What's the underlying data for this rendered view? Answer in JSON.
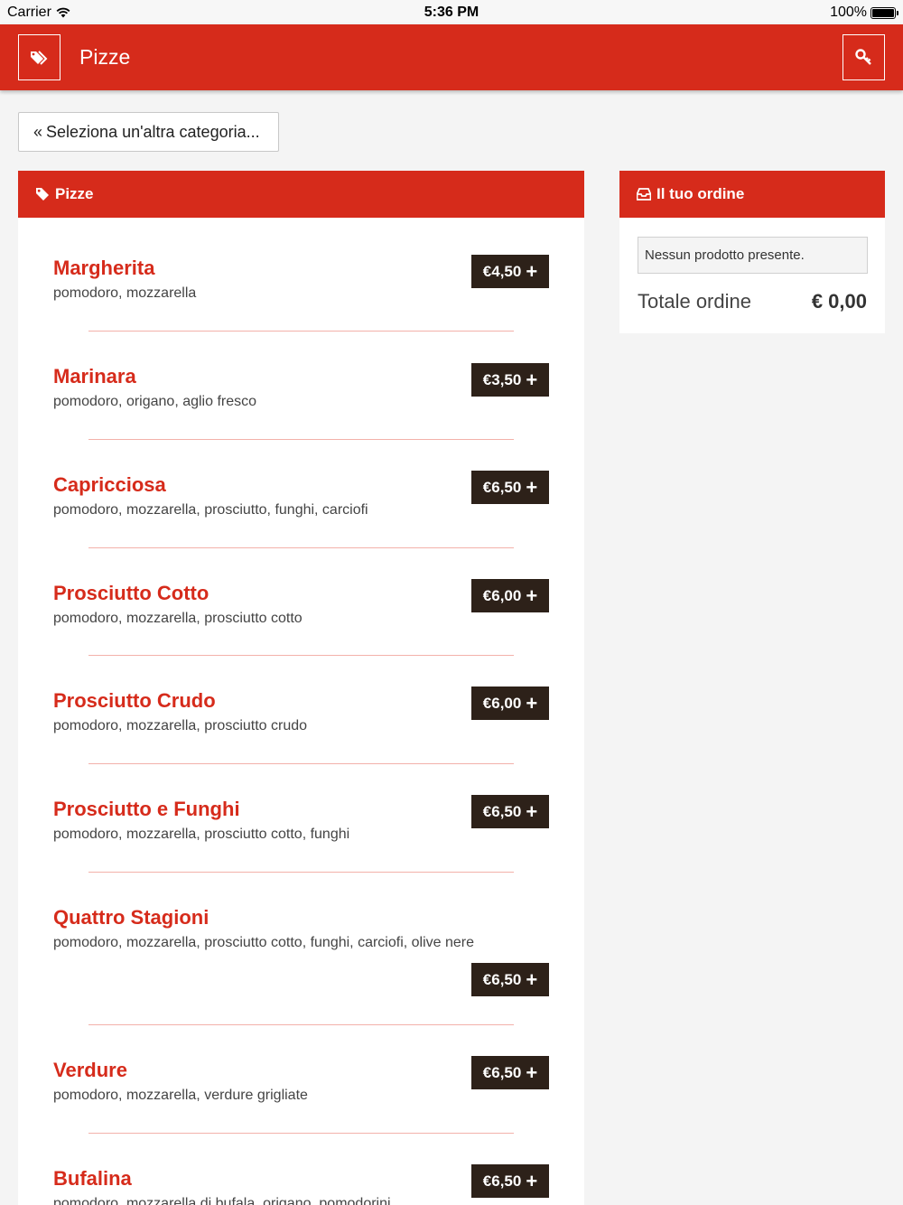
{
  "status_bar": {
    "carrier": "Carrier",
    "time": "5:36 PM",
    "battery": "100%"
  },
  "navbar": {
    "title": "Pizze",
    "left_icon": "tags-icon",
    "right_icon": "key-icon"
  },
  "back_button": {
    "label": "Seleziona un'altra categoria...",
    "icon": "double-chevron-left-icon"
  },
  "menu_panel": {
    "title": "Pizze",
    "items": [
      {
        "name": "Margherita",
        "desc": "pomodoro, mozzarella",
        "price": "€4,50"
      },
      {
        "name": "Marinara",
        "desc": "pomodoro, origano, aglio fresco",
        "price": "€3,50"
      },
      {
        "name": "Capricciosa",
        "desc": "pomodoro, mozzarella, prosciutto, funghi, carciofi",
        "price": "€6,50"
      },
      {
        "name": "Prosciutto Cotto",
        "desc": "pomodoro, mozzarella, prosciutto cotto",
        "price": "€6,00"
      },
      {
        "name": "Prosciutto Crudo",
        "desc": "pomodoro, mozzarella, prosciutto crudo",
        "price": "€6,00"
      },
      {
        "name": "Prosciutto e Funghi",
        "desc": "pomodoro, mozzarella, prosciutto cotto, funghi",
        "price": "€6,50"
      },
      {
        "name": "Quattro Stagioni",
        "desc": "pomodoro, mozzarella, prosciutto cotto, funghi, carciofi, olive nere",
        "price": "€6,50"
      },
      {
        "name": "Verdure",
        "desc": "pomodoro, mozzarella, verdure grigliate",
        "price": "€6,50"
      },
      {
        "name": "Bufalina",
        "desc": "pomodoro, mozzarella di bufala, origano, pomodorini",
        "price": "€6,50"
      }
    ]
  },
  "order_panel": {
    "title": "Il tuo ordine",
    "empty_text": "Nessun prodotto presente.",
    "total_label": "Totale ordine",
    "total_value": "€ 0,00"
  },
  "colors": {
    "brand": "#d62b1b",
    "price_button": "#2d2119"
  }
}
